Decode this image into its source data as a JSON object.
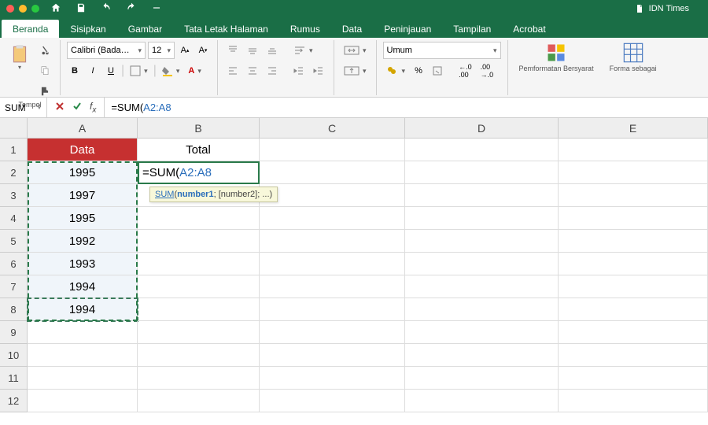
{
  "doc_title": "IDN Times",
  "tabs": {
    "beranda": "Beranda",
    "sisipkan": "Sisipkan",
    "gambar": "Gambar",
    "tata_letak": "Tata Letak Halaman",
    "rumus": "Rumus",
    "data": "Data",
    "peninjauan": "Peninjauan",
    "tampilan": "Tampilan",
    "acrobat": "Acrobat"
  },
  "ribbon": {
    "paste_label": "Tempel",
    "font_family": "Calibri (Bada…",
    "font_size": "12",
    "bold": "B",
    "italic": "I",
    "underline": "U",
    "a_caret_up": "A▴",
    "a_caret_down": "A▾",
    "indent_group": "",
    "number_format": "Umum",
    "cond_fmt": "Pemformatan Bersyarat",
    "format_table": "Forma sebagai"
  },
  "namebox": "SUM",
  "formula": {
    "prefix": "=SUM(",
    "range": "A2:A8"
  },
  "tooltip": {
    "fn": "SUM",
    "sig": "(",
    "arg1": "number1",
    "rest": "; [number2]; ...)"
  },
  "columns": [
    "A",
    "B",
    "C",
    "D",
    "E"
  ],
  "cells": {
    "A1": "Data",
    "B1": "Total",
    "A2": "1995",
    "A3": "1997",
    "A4": "1995",
    "A5": "1992",
    "A6": "1993",
    "A7": "1994",
    "A8": "1994"
  },
  "chart_data": {
    "type": "table",
    "title": "Data",
    "categories": [
      "A2",
      "A3",
      "A4",
      "A5",
      "A6",
      "A7",
      "A8"
    ],
    "values": [
      1995,
      1997,
      1995,
      1992,
      1993,
      1994,
      1994
    ]
  }
}
